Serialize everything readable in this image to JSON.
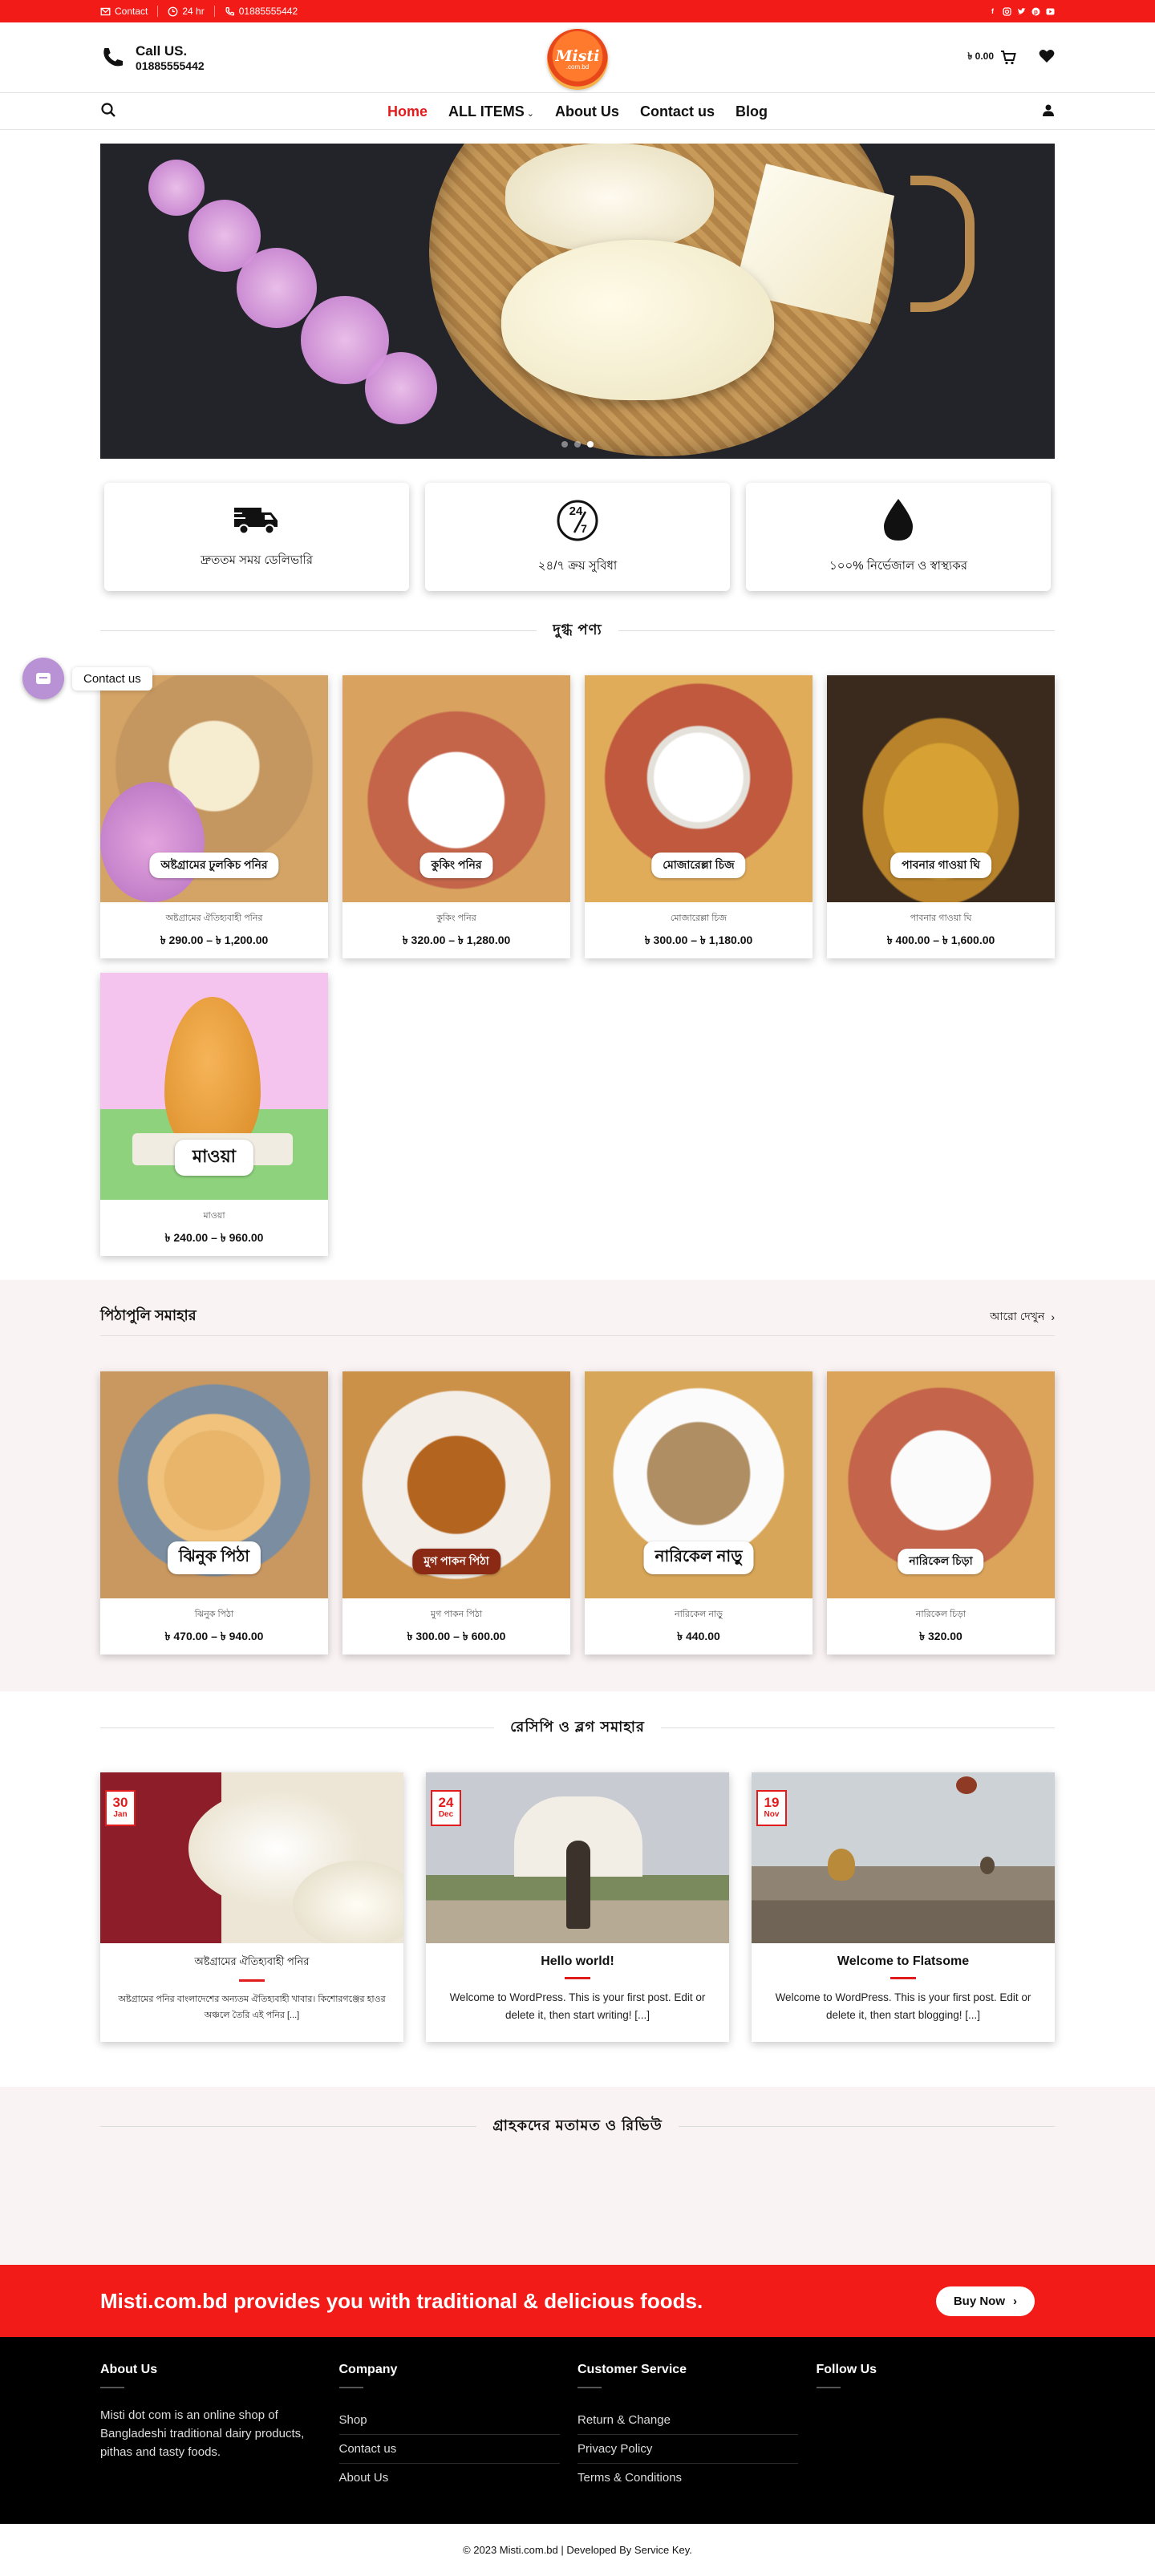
{
  "topbar": {
    "contact": "Contact",
    "hours": "24 hr",
    "phone": "01885555442",
    "social": [
      "facebook-icon",
      "instagram-icon",
      "twitter-icon",
      "pinterest-icon",
      "youtube-icon"
    ]
  },
  "header": {
    "call_title": "Call US.",
    "call_number": "01885555442",
    "logo_text": "Misti",
    "logo_sub": ".com.bd",
    "cart_amount": "৳ 0.00"
  },
  "nav": {
    "items": [
      {
        "label": "Home",
        "active": true
      },
      {
        "label": "ALL ITEMS",
        "dropdown": true
      },
      {
        "label": "About Us"
      },
      {
        "label": "Contact us"
      },
      {
        "label": "Blog"
      }
    ]
  },
  "features": [
    {
      "icon": "truck-icon",
      "label": "দ্রুততম সময় ডেলিভারি"
    },
    {
      "icon": "clock-24-7-icon",
      "label": "২৪/৭ ক্রয় সুবিধা"
    },
    {
      "icon": "drop-icon",
      "label": "১০০% নির্ভেজাল ও স্বাস্থ্যকর"
    }
  ],
  "dairy": {
    "title": "দুগ্ধ পণ্য",
    "products": [
      {
        "name": "অষ্টগ্রামের ঐতিহ্যবাহী পনির",
        "price": "৳ 290.00 – ৳ 1,200.00",
        "tag": "অষ্টগ্রামের ঢুলকিচ পনির"
      },
      {
        "name": "কুকিং পনির",
        "price": "৳ 320.00 – ৳ 1,280.00",
        "tag": "কুকিং পনির"
      },
      {
        "name": "মোজারেল্লা চিজ",
        "price": "৳ 300.00 – ৳ 1,180.00",
        "tag": "মোজারেল্লা চিজ"
      },
      {
        "name": "পাবনার গাওয়া ঘি",
        "price": "৳ 400.00 – ৳ 1,600.00",
        "tag": "পাবনার গাওয়া ঘি"
      },
      {
        "name": "মাওয়া",
        "price": "৳ 240.00 – ৳ 960.00",
        "tag": "মাওয়া"
      }
    ]
  },
  "pitha": {
    "title": "পিঠাপুলি সমাহার",
    "more": "আরো দেখুন",
    "products": [
      {
        "name": "ঝিনুক পিঠা",
        "price": "৳ 470.00 – ৳ 940.00",
        "tag": "ঝিনুক পিঠা"
      },
      {
        "name": "মুগ পাকন পিঠা",
        "price": "৳ 300.00 – ৳ 600.00",
        "tag": "মুগ পাকন পিঠা"
      },
      {
        "name": "নারিকেল নাড়ু",
        "price": "৳ 440.00",
        "tag": "নারিকেল নাড়ু"
      },
      {
        "name": "নারিকেল চিড়া",
        "price": "৳ 320.00",
        "tag": "নারিকেল চিড়া"
      }
    ]
  },
  "blog": {
    "title": "রেসিপি ও ব্লগ সমাহার",
    "posts": [
      {
        "day": "30",
        "month": "Jan",
        "title": "অষ্টগ্রামের ঐতিহ্যবাহী পনির",
        "excerpt": "অষ্টগ্রামের পনির বাংলাদেশের অন্যতম ঐতিহ্যবাহী খাবার। কিশোরগঞ্জের হাওর অঞ্চলে তৈরি এই পনির [...]"
      },
      {
        "day": "24",
        "month": "Dec",
        "title": "Hello world!",
        "excerpt": "Welcome to WordPress. This is your first post. Edit or delete it, then start writing! [...]"
      },
      {
        "day": "19",
        "month": "Nov",
        "title": "Welcome to Flatsome",
        "excerpt": "Welcome to WordPress. This is your first post. Edit or delete it, then start blogging! [...]"
      }
    ]
  },
  "reviews": {
    "title": "গ্রাহকদের মতামত ও রিভিউ"
  },
  "cta": {
    "text": "Misti.com.bd provides you with traditional & delicious foods.",
    "button": "Buy Now"
  },
  "footer": {
    "about_title": "About Us",
    "about_text": "Misti dot com is an online shop of Bangladeshi traditional dairy products, pithas and tasty foods.",
    "company_title": "Company",
    "company_links": [
      "Shop",
      "Contact us",
      "About Us"
    ],
    "service_title": "Customer Service",
    "service_links": [
      "Return & Change",
      "Privacy Policy",
      "Terms & Conditions"
    ],
    "follow_title": "Follow Us",
    "copyright": "© 2023 Misti.com.bd | Developed By Service Key."
  },
  "float_contact": {
    "label": "Contact us"
  },
  "colors": {
    "brand_red": "#f21b17",
    "accent_red": "#e21c1c"
  }
}
